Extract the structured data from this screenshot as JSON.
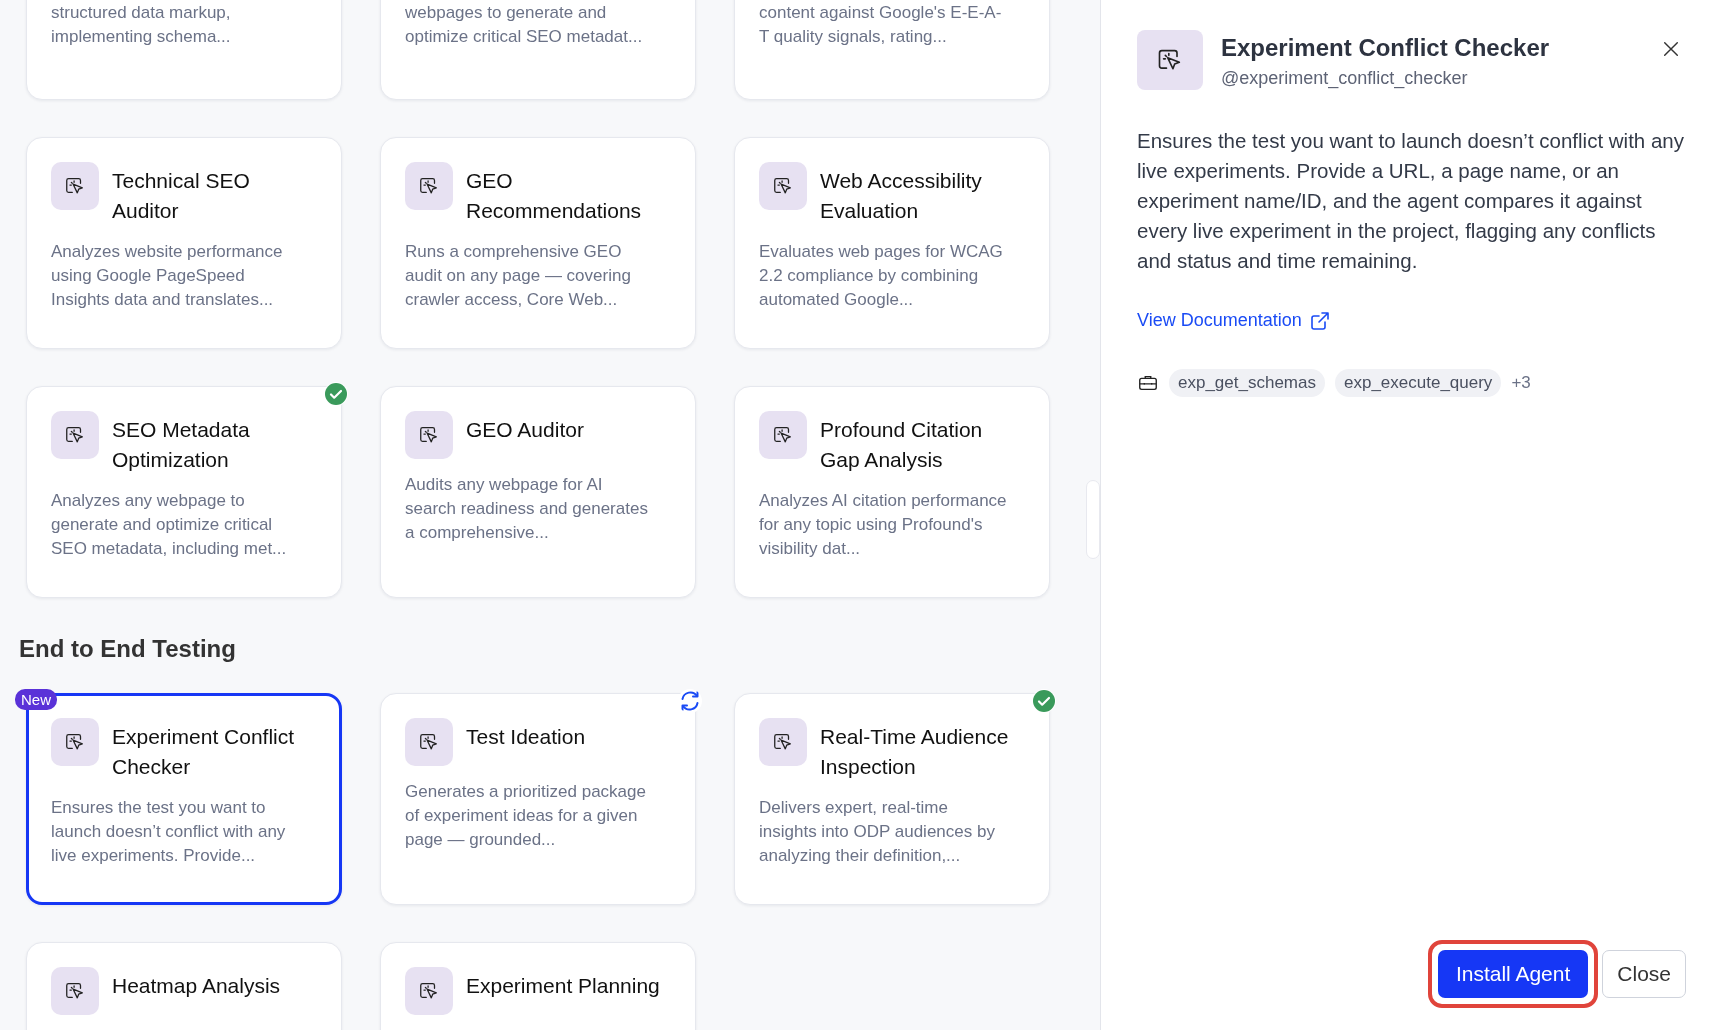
{
  "sections": [
    {
      "cards": [
        {
          "kind": "cut",
          "description": "structured data markup, implementing schema..."
        },
        {
          "kind": "cut",
          "description": "webpages to generate and optimize critical SEO metadat..."
        },
        {
          "kind": "cut",
          "description": "content against Google's E-E-A-T quality signals, rating..."
        },
        {
          "kind": "full",
          "title": "Technical SEO Auditor",
          "description": "Analyzes website performance using Google PageSpeed Insights data and translates...",
          "installed": false,
          "update_available": false,
          "selected": false
        },
        {
          "kind": "full",
          "title": "GEO Recommendations",
          "description": "Runs a comprehensive GEO audit on any page — covering crawler access, Core Web...",
          "installed": false,
          "update_available": false,
          "selected": false
        },
        {
          "kind": "full",
          "title": "Web Accessibility Evaluation",
          "description": "Evaluates web pages for WCAG 2.2 compliance by combining automated Google...",
          "installed": false,
          "update_available": false,
          "selected": false
        },
        {
          "kind": "full",
          "title": "SEO Metadata Optimization",
          "description": "Analyzes any webpage to generate and optimize critical SEO metadata, including met...",
          "installed": true,
          "update_available": false,
          "selected": false
        },
        {
          "kind": "full",
          "title": "GEO Auditor",
          "description": "Audits any webpage for AI search readiness and generates a comprehensive...",
          "installed": false,
          "update_available": false,
          "selected": false
        },
        {
          "kind": "full",
          "title": "Profound Citation Gap Analysis",
          "description": "Analyzes AI citation performance for any topic using Profound's visibility dat...",
          "installed": false,
          "update_available": false,
          "selected": false
        }
      ]
    },
    {
      "heading": "End to End Testing",
      "cards": [
        {
          "kind": "full",
          "title": "Experiment Conflict Checker",
          "description": "Ensures the test you want to launch doesn’t conflict with any live experiments. Provide...",
          "installed": false,
          "update_available": false,
          "selected": true,
          "badge": "New"
        },
        {
          "kind": "full",
          "title": "Test Ideation",
          "description": "Generates a prioritized package of experiment ideas for a given page — grounded...",
          "installed": false,
          "update_available": true,
          "selected": false
        },
        {
          "kind": "full",
          "title": "Real-Time Audience Inspection",
          "description": "Delivers expert, real-time insights into ODP audiences by analyzing their definition,...",
          "installed": true,
          "update_available": false,
          "selected": false
        },
        {
          "kind": "top",
          "title": "Heatmap Analysis"
        },
        {
          "kind": "top",
          "title": "Experiment Planning"
        }
      ]
    }
  ],
  "panel": {
    "title": "Experiment Conflict Checker",
    "handle": "@experiment_conflict_checker",
    "description": "Ensures the test you want to launch doesn’t conflict with any live experiments. Provide a URL, a page name, or an experiment name/ID, and the agent compares it against every live experiment in the project, flagging any conflicts and status and time remaining.",
    "link": "View Documentation",
    "tools": [
      "exp_get_schemas",
      "exp_execute_query"
    ],
    "more_tools": "+3",
    "primary_button": "Install Agent",
    "secondary_button": "Close"
  }
}
